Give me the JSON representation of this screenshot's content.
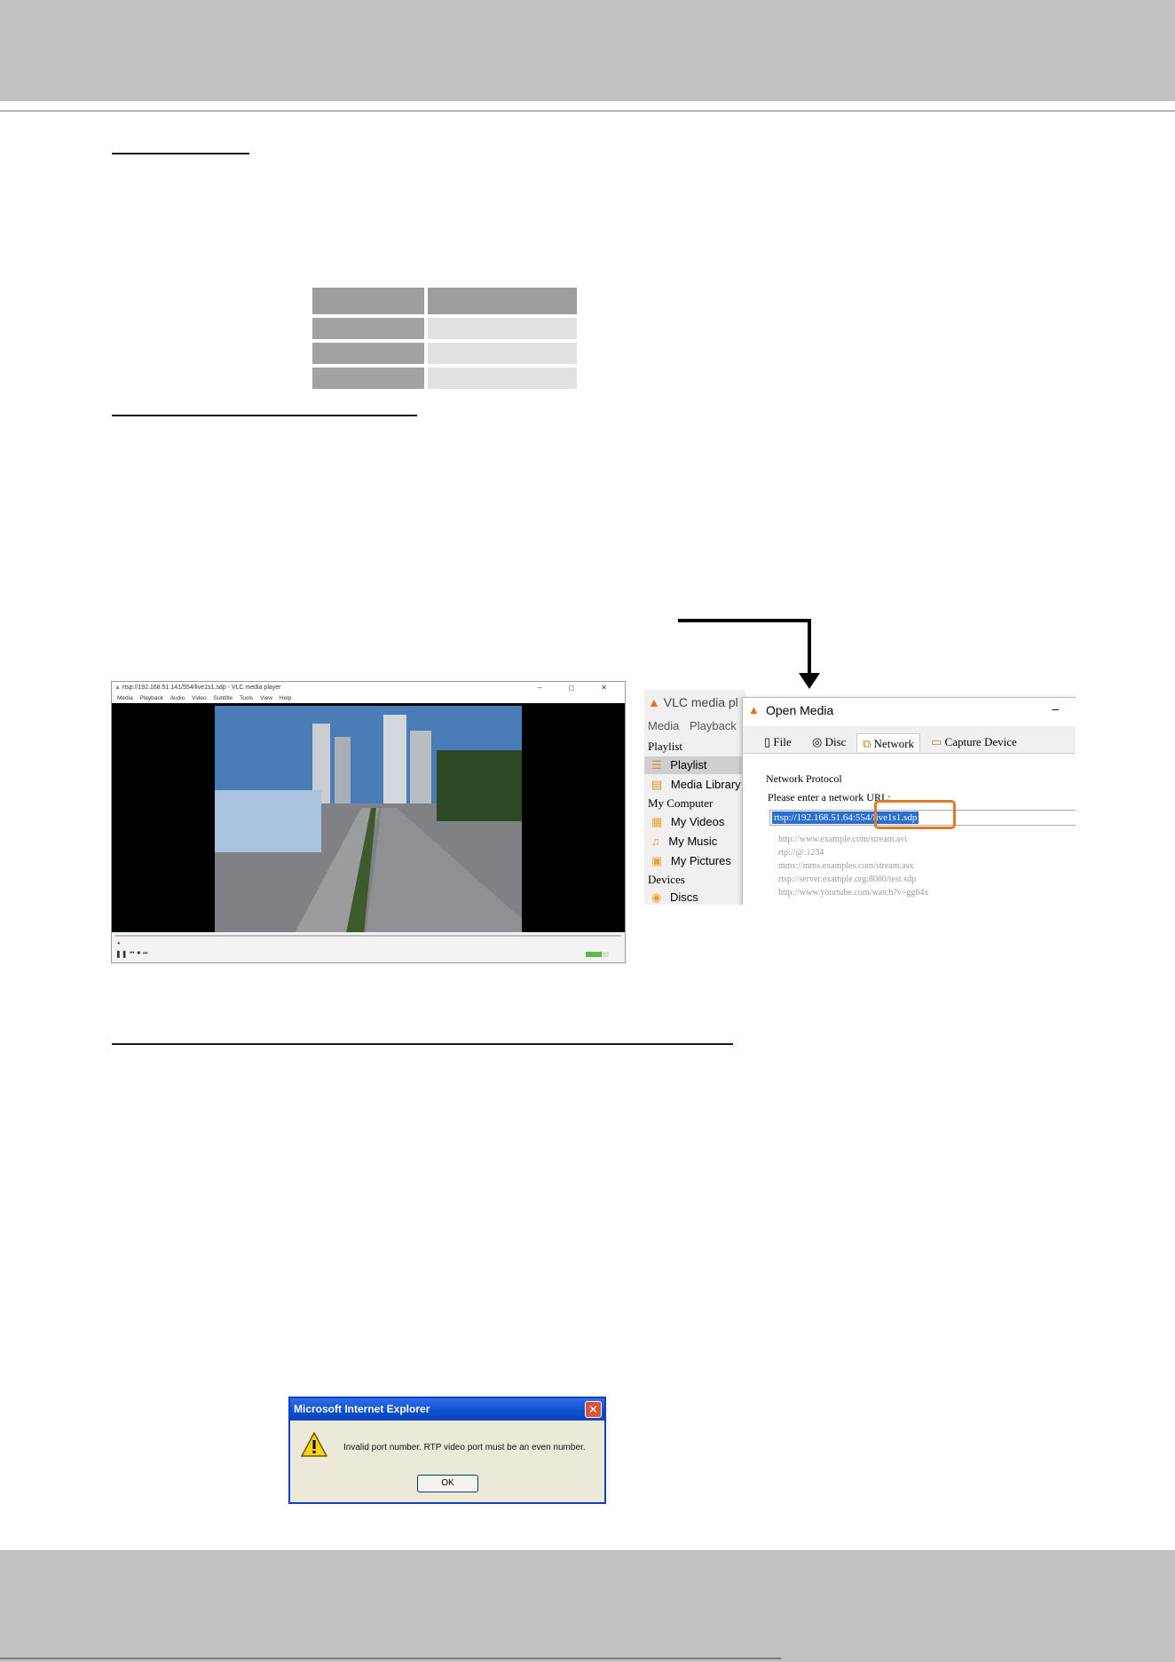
{
  "table": {
    "header": [
      "",
      ""
    ],
    "rows": [
      [
        "",
        ""
      ],
      [
        "",
        ""
      ],
      [
        "",
        ""
      ]
    ]
  },
  "vlc_player": {
    "window_title": "rtsp://192.168.51.141/554/live1s1.sdp - VLC media player",
    "menu": [
      "Media",
      "Playback",
      "Audio",
      "Video",
      "Subtitle",
      "Tools",
      "View",
      "Help"
    ],
    "window_buttons": "– ◻ ✕"
  },
  "open_media": {
    "app_title": "VLC media pl",
    "app_menu": [
      "Media",
      "Playback"
    ],
    "sidebar": {
      "playlist_heading": "Playlist",
      "playlist_item": "Playlist",
      "media_library": "Media Library",
      "my_computer_heading": "My Computer",
      "my_videos": "My Videos",
      "my_music": "My Music",
      "my_pictures": "My Pictures",
      "devices_heading": "Devices",
      "discs": "Discs"
    },
    "dialog_title": "Open Media",
    "minimize": "–",
    "tabs": [
      "File",
      "Disc",
      "Network",
      "Capture Device"
    ],
    "protocol_label": "Network Protocol",
    "url_label": "Please enter a network URL:",
    "url_value": "rtsp://192.168.51.64:554/live1s1.sdp",
    "examples": [
      "http://www.example.com/stream.avi",
      "rtp://@:1234",
      "mms://mms.examples.com/stream.asx",
      "rtsp://server.example.org:8080/test.sdp",
      "http://www.yourtube.com/watch?v=gg64x"
    ]
  },
  "error_dialog": {
    "title": "Microsoft Internet Explorer",
    "message": "Invalid port number. RTP video port must be an even number.",
    "ok_label": "OK"
  },
  "colors": {
    "header_band": "#c0c1c1",
    "highlight": "#e07a27",
    "xp_title": "#0a4fd0"
  }
}
